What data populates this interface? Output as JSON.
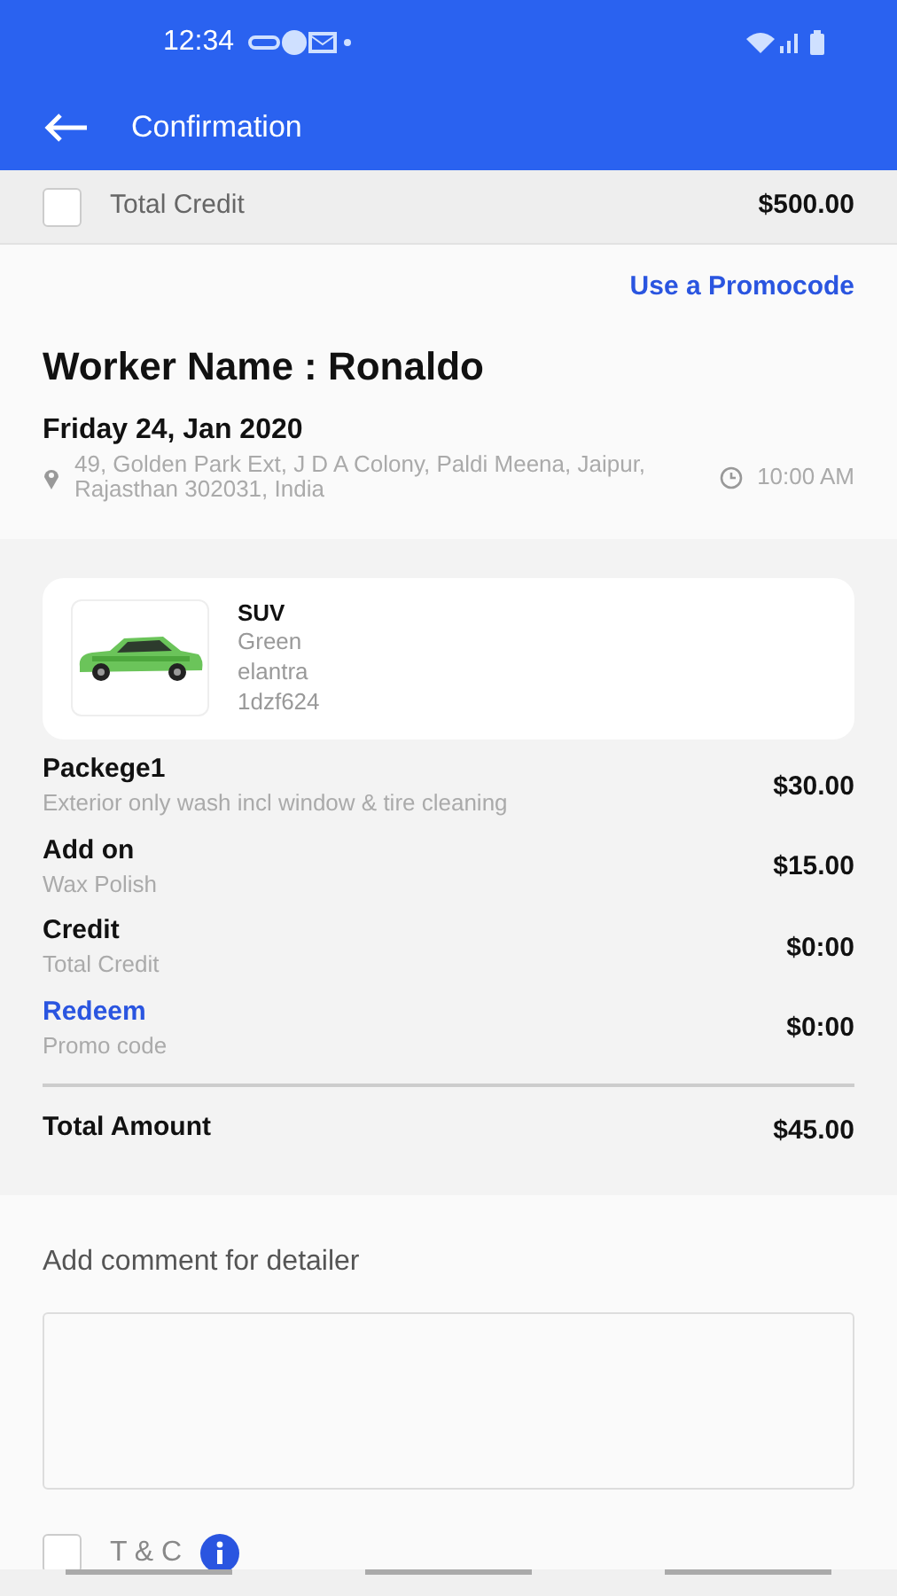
{
  "status_bar": {
    "time": "12:34"
  },
  "app_bar": {
    "title": "Confirmation"
  },
  "total_credit": {
    "label": "Total Credit",
    "amount": "$500.00",
    "checked": false
  },
  "promo_link": "Use a Promocode",
  "worker_name": "Worker Name : Ronaldo",
  "date": "Friday 24, Jan 2020",
  "address": "49, Golden Park Ext, J D A Colony, Paldi Meena, Jaipur, Rajasthan 302031, India",
  "time": "10:00 AM",
  "vehicle": {
    "type": "SUV",
    "paint": "Green",
    "model": "elantra",
    "plate": "1dzf624"
  },
  "line_items": [
    {
      "kind": "plain",
      "title": "Packege1",
      "subtitle": "Exterior only wash incl window & tire cleaning",
      "amount": "$30.00"
    },
    {
      "kind": "plain",
      "title": "Add on",
      "subtitle": "Wax Polish",
      "amount": "$15.00"
    },
    {
      "kind": "plain",
      "title": "Credit",
      "subtitle": "Total Credit",
      "amount": "$0:00"
    },
    {
      "kind": "link",
      "title": "Redeem",
      "subtitle": "Promo code",
      "amount": "$0:00"
    }
  ],
  "total": {
    "label": "Total Amount",
    "amount": "$45.00"
  },
  "comment": {
    "label": "Add comment for detailer"
  },
  "terms": {
    "label": "T & C",
    "checked": false
  }
}
